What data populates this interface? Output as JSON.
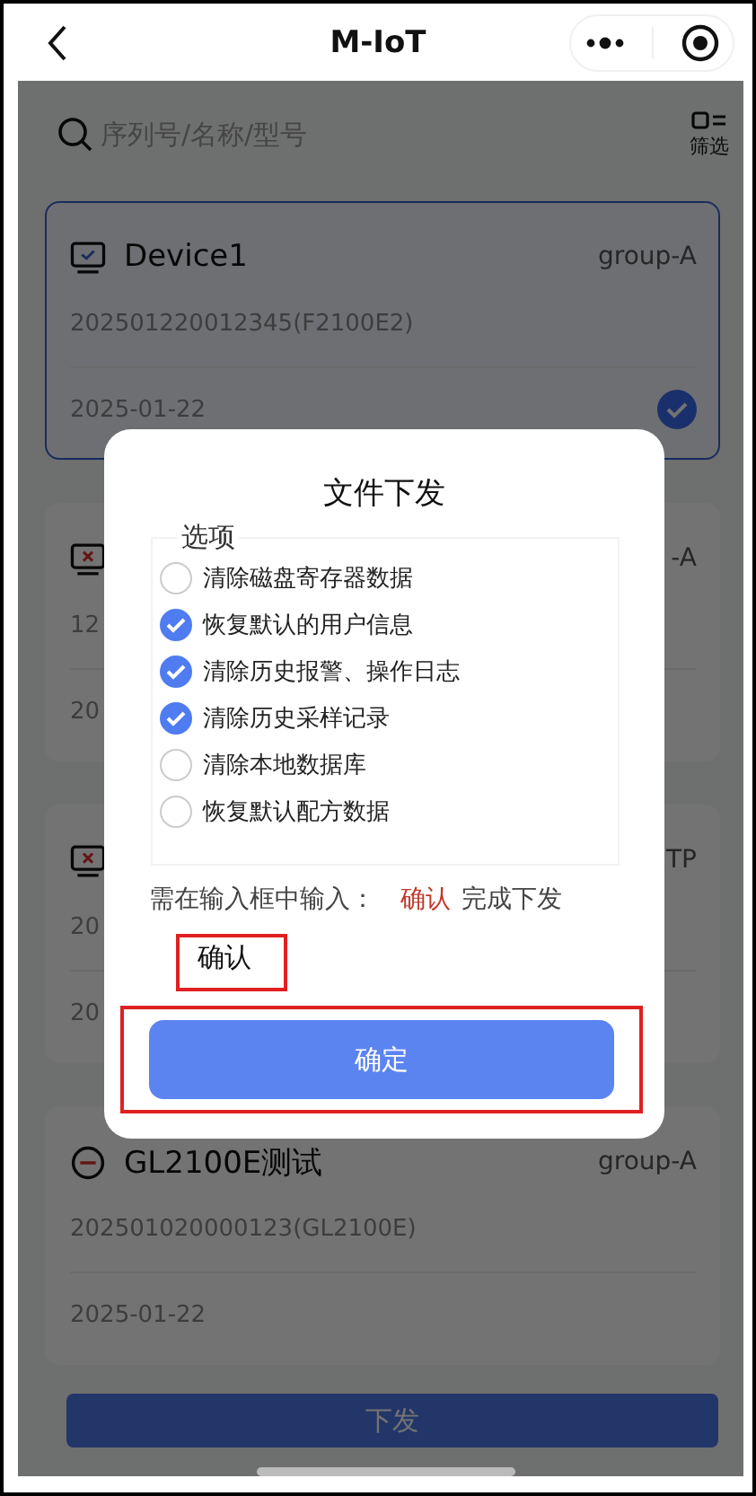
{
  "header": {
    "title": "M-IoT"
  },
  "search": {
    "placeholder": "序列号/名称/型号",
    "filter_label": "筛选"
  },
  "devices": [
    {
      "kind": "online",
      "name": "Device1",
      "group": "group-A",
      "serial": "202501220012345(F2100E2)",
      "date": "2025-01-22",
      "selected": true
    },
    {
      "kind": "error",
      "group": "-A",
      "serial": "12",
      "date": "20",
      "selected": false
    },
    {
      "kind": "error",
      "group": "TP",
      "serial": "20",
      "date": "20",
      "selected": false
    },
    {
      "kind": "disabled",
      "name": "GL2100E测试",
      "group": "group-A",
      "serial": "202501020000123(GL2100E)",
      "date": "2025-01-22",
      "selected": false
    }
  ],
  "action_button": "下发",
  "dialog": {
    "title": "文件下发",
    "options_legend": "选项",
    "options": [
      {
        "label": "清除磁盘寄存器数据",
        "checked": false
      },
      {
        "label": "恢复默认的用户信息",
        "checked": true
      },
      {
        "label": "清除历史报警、操作日志",
        "checked": true
      },
      {
        "label": "清除历史采样记录",
        "checked": true
      },
      {
        "label": "清除本地数据库",
        "checked": false
      },
      {
        "label": "恢复默认配方数据",
        "checked": false
      }
    ],
    "hint_prefix": "需在输入框中输入：",
    "hint_keyword": "确认",
    "hint_suffix": "完成下发",
    "input_value": "确认",
    "confirm_button": "确定"
  }
}
